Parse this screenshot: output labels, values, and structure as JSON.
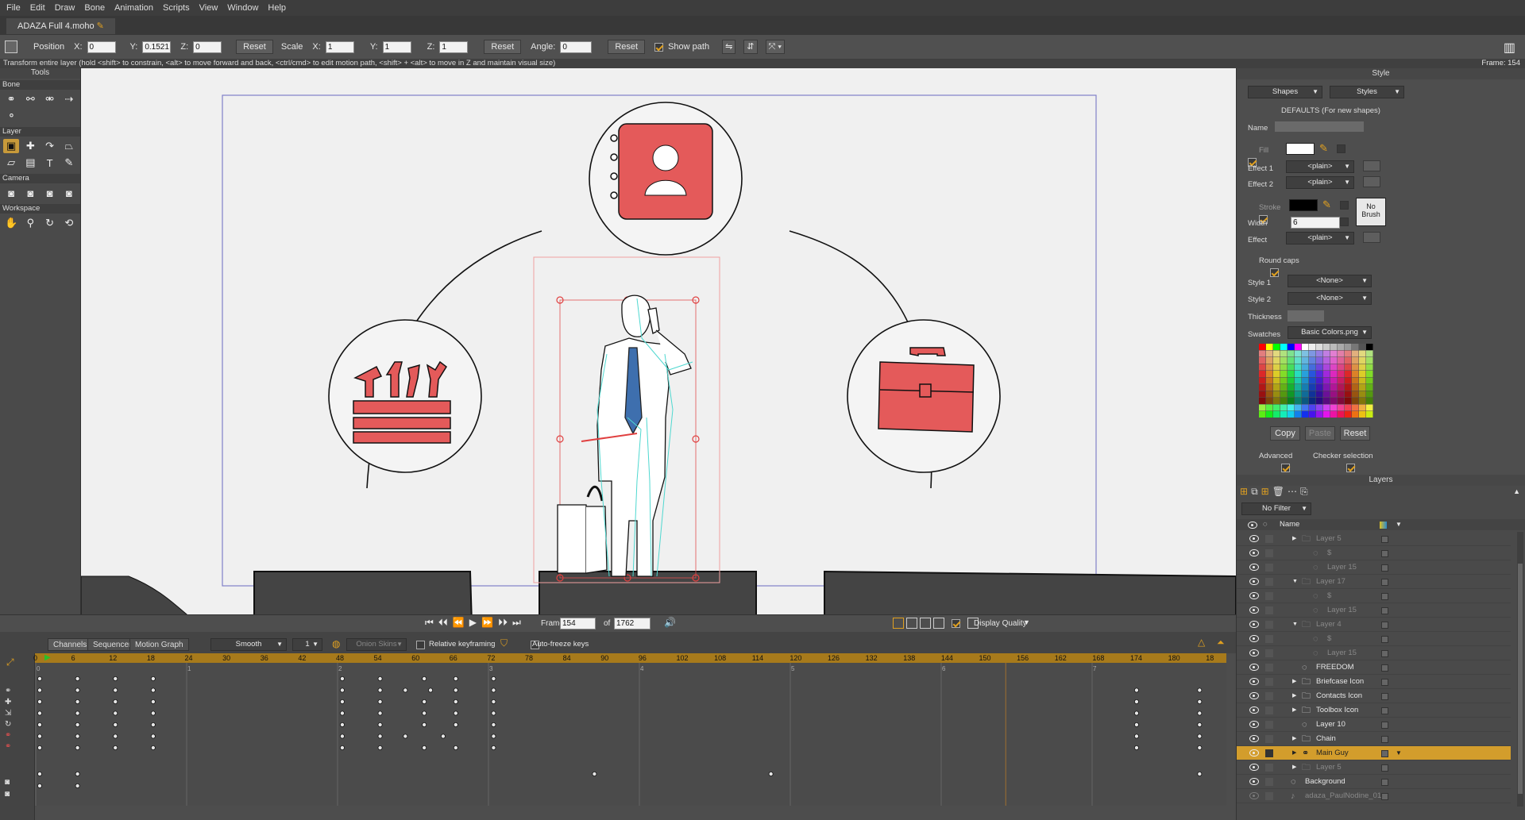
{
  "menu": [
    "File",
    "Edit",
    "Draw",
    "Bone",
    "Animation",
    "Scripts",
    "View",
    "Window",
    "Help"
  ],
  "doc_tab": "ADAZA Full 4.moho",
  "toolbar": {
    "position_label": "Position",
    "x_label": "X:",
    "x_value": "0",
    "y_label": "Y:",
    "y_value": "0.1521",
    "z_label": "Z:",
    "z_value": "0",
    "reset1": "Reset",
    "scale_label": "Scale",
    "sx_label": "X:",
    "sx_value": "1",
    "sy_label": "Y:",
    "sy_value": "1",
    "sz_label": "Z:",
    "sz_value": "1",
    "reset2": "Reset",
    "angle_label": "Angle:",
    "angle_value": "0",
    "reset3": "Reset",
    "show_path": "Show path"
  },
  "hint": "Transform entire layer (hold <shift> to constrain, <alt> to move forward and back, <ctrl/cmd> to edit motion path, <shift> + <alt> to move in Z and maintain visual size)",
  "frame_indicator": "Frame: 154",
  "tools": {
    "title": "Tools",
    "sections": [
      "Bone",
      "Layer",
      "Camera",
      "Workspace"
    ]
  },
  "playback": {
    "frame_label": "Frame",
    "frame_value": "154",
    "of_label": "of",
    "total_value": "1762",
    "display_quality": "Display Quality"
  },
  "timeline": {
    "tabs": [
      "Channels",
      "Sequencer",
      "Motion Graph"
    ],
    "interp": "Smooth",
    "interp_num": "1",
    "onion": "Onion Skins",
    "relative": "Relative keyframing",
    "autofreeze": "Auto-freeze keys",
    "ruler": [
      "0",
      "6",
      "12",
      "18",
      "24",
      "30",
      "36",
      "42",
      "48",
      "54",
      "60",
      "66",
      "72",
      "78",
      "84",
      "90",
      "96",
      "102",
      "108",
      "114",
      "120",
      "126",
      "132",
      "138",
      "144",
      "150",
      "156",
      "162",
      "168",
      "174",
      "180",
      "18"
    ],
    "markers": [
      "0",
      "1",
      "2",
      "3",
      "4",
      "5",
      "6",
      "7"
    ]
  },
  "style": {
    "title": "Style",
    "shapes": "Shapes",
    "styles": "Styles",
    "defaults": "DEFAULTS (For new shapes)",
    "name_label": "Name",
    "fill_label": "Fill",
    "effect1_label": "Effect 1",
    "effect1": "<plain>",
    "effect2_label": "Effect 2",
    "effect2": "<plain>",
    "stroke_label": "Stroke",
    "width_label": "Width",
    "width_value": "6",
    "effect_label": "Effect",
    "effect": "<plain>",
    "no_brush": "No Brush",
    "round_caps": "Round caps",
    "style1_label": "Style 1",
    "style1": "<None>",
    "style2_label": "Style 2",
    "style2": "<None>",
    "thickness_label": "Thickness",
    "swatches_label": "Swatches",
    "swatches": "Basic Colors.png",
    "copy": "Copy",
    "paste": "Paste",
    "reset": "Reset",
    "advanced": "Advanced",
    "checker": "Checker selection",
    "fill_color": "#ffffff",
    "stroke_color": "#000000"
  },
  "layers": {
    "title": "Layers",
    "filter": "No Filter",
    "col_name": "Name",
    "rows": [
      {
        "name": "Layer 5",
        "indent": 3,
        "type": "group",
        "dim": true
      },
      {
        "name": "$",
        "indent": 4,
        "type": "vector",
        "dim": true
      },
      {
        "name": "Layer 15",
        "indent": 4,
        "type": "vector",
        "dim": true
      },
      {
        "name": "Layer 17",
        "indent": 3,
        "type": "group",
        "dim": true,
        "expanded": true
      },
      {
        "name": "$",
        "indent": 4,
        "type": "vector",
        "dim": true
      },
      {
        "name": "Layer 15",
        "indent": 4,
        "type": "vector",
        "dim": true
      },
      {
        "name": "Layer 4",
        "indent": 3,
        "type": "group",
        "dim": true,
        "expanded": true
      },
      {
        "name": "$",
        "indent": 4,
        "type": "vector",
        "dim": true
      },
      {
        "name": "Layer 15",
        "indent": 4,
        "type": "vector",
        "dim": true
      },
      {
        "name": "FREEDOM",
        "indent": 3,
        "type": "vector"
      },
      {
        "name": "Briefcase Icon",
        "indent": 3,
        "type": "group"
      },
      {
        "name": "Contacts Icon",
        "indent": 3,
        "type": "group"
      },
      {
        "name": "Toolbox Icon",
        "indent": 3,
        "type": "group"
      },
      {
        "name": "Layer 10",
        "indent": 3,
        "type": "vector"
      },
      {
        "name": "Chain",
        "indent": 3,
        "type": "group"
      },
      {
        "name": "Main Guy",
        "indent": 3,
        "type": "bone",
        "selected": true
      },
      {
        "name": "Layer 5",
        "indent": 3,
        "type": "group",
        "dim": true
      },
      {
        "name": "Background",
        "indent": 2,
        "type": "vector"
      },
      {
        "name": "adaza_PaulNodine_01...",
        "indent": 2,
        "type": "audio",
        "dim": true
      }
    ]
  },
  "colors": {
    "accent": "#d39d2c",
    "icon_red": "#e45a5a",
    "tie_blue": "#3e6fae",
    "bone_cyan": "#4fd8d0"
  }
}
